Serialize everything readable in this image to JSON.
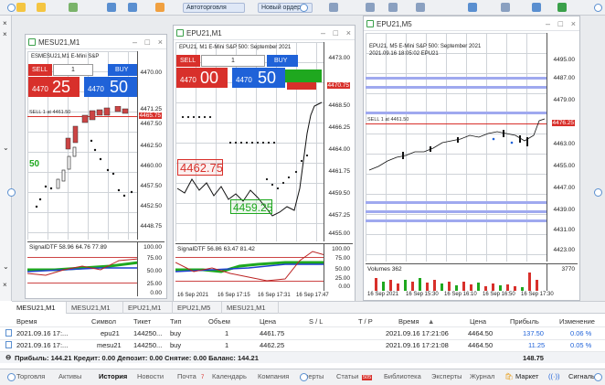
{
  "toolbar": {
    "algo_label": "Автоторговля",
    "new_order_label": "Новый ордер"
  },
  "charts": [
    {
      "title": "MESU21,M1",
      "trade_title": "ESMESU21,M1 E-Mini S&P",
      "sell_label": "SELL",
      "buy_label": "BUY",
      "volume": "1",
      "sell_small": "4470",
      "sell_big": "25",
      "buy_small": "4470",
      "buy_big": "50",
      "trade_line_label": "SELL 1 at 4461.50",
      "current_price": "4465.75",
      "price_levels": [
        "4471.25",
        "4470.00",
        "4467.50",
        "4465.00",
        "4462.50",
        "4460.00",
        "4457.50",
        "4455.00",
        "4452.50",
        "4450.00",
        "4448.75"
      ],
      "visible_levels": [
        "4471.25",
        "4470.00",
        "4467.50",
        "4465.00",
        "4462.50",
        "4460.00",
        "4457.50",
        "4455.00",
        "4452.50",
        "4450.00",
        "4448.75"
      ],
      "marker": "50",
      "ind_label": "SignalDTF 58.96 64.76 77.89",
      "ind_levels": [
        "100.00",
        "75.00",
        "50.00",
        "25.00",
        "0.00"
      ]
    },
    {
      "title": "EPU21,M1",
      "trade_title": "EPU21, M1 E-Mini S&P 500: September 2021",
      "sell_label": "SELL",
      "buy_label": "BUY",
      "volume": "1",
      "sell_small": "4470",
      "sell_big": "00",
      "buy_small": "4470",
      "buy_big": "50",
      "price_levels": [
        "4473.00",
        "4470.75",
        "4468.50",
        "4466.25",
        "4464.00",
        "4461.75",
        "4459.50",
        "4457.25",
        "4455.00"
      ],
      "current_price": "4470.75",
      "box_label_1": "4462.75",
      "box_label_2": "4459.25",
      "ind_label": "SignalDTF 56.86 63.47 81.42",
      "ind_levels": [
        "100.00",
        "75.00",
        "50.00",
        "25.00",
        "0.00"
      ],
      "time_labels": [
        "16 Sep 2021",
        "16 Sep 17:15",
        "16 Sep 17:31",
        "16 Sep 17:47"
      ]
    },
    {
      "title": "EPU21,M5",
      "trade_title": "EPU21, M5  E-Mini S&P 500: September 2021",
      "info_line": "2021.09.16 18:05:02 EPU21",
      "trade_line_label": "SELL 1 at 4461.50",
      "current_price": "4476.25",
      "price_levels": [
        "4495.00",
        "4487.00",
        "4479.00",
        "4471.00",
        "4463.00",
        "4455.00",
        "4447.00",
        "4439.00",
        "4431.00",
        "4423.00",
        "4415.00"
      ],
      "vol_label": "Volumes 362",
      "vol_max": "3770",
      "time_labels": [
        "16 Sep 2021",
        "16 Sep 15:30",
        "16 Sep 16:10",
        "16 Sep 16:50",
        "16 Sep 17:30"
      ]
    }
  ],
  "chart_tabs": [
    "MESU21,M1",
    "MESU21,M1",
    "EPU21,M1",
    "EPU21,M5",
    "MESU21,M1"
  ],
  "table": {
    "headers": [
      "Время",
      "Символ",
      "Тикет",
      "Тип",
      "Объем",
      "Цена",
      "S / L",
      "T / P",
      "Время",
      "Цена",
      "Прибыль",
      "Изменение"
    ],
    "sort_marker": "▲",
    "rows": [
      [
        "2021.09.16 17:...",
        "epu21",
        "144250...",
        "buy",
        "1",
        "4461.75",
        "",
        "",
        "2021.09.16 17:21:06",
        "4464.50",
        "137.50",
        "0.06 %"
      ],
      [
        "2021.09.16 17:...",
        "mesu21",
        "144250...",
        "buy",
        "1",
        "4462.25",
        "",
        "",
        "2021.09.16 17:21:08",
        "4464.50",
        "11.25",
        "0.05 %"
      ]
    ],
    "summary": "Прибыль: 144.21  Кредит: 0.00  Депозит: 0.00  Снятие: 0.00  Баланс: 144.21",
    "summary_total": "148.75"
  },
  "bottom_tabs": [
    "Торговля",
    "Активы",
    "История",
    "Новости",
    "Почта",
    "Календарь",
    "Компания",
    "Алерты",
    "Статьи",
    "Библиотека",
    "Эксперты",
    "Журнал"
  ],
  "bottom_badges": {
    "mail": "7",
    "articles": "505"
  },
  "bottom_right": {
    "market": "Маркет",
    "signals": "Сигналы"
  },
  "colors": {
    "sell": "#d8302b",
    "buy": "#1f62d8",
    "profit": "#1f62d8",
    "green": "#1fa81f",
    "red": "#d8302b"
  }
}
